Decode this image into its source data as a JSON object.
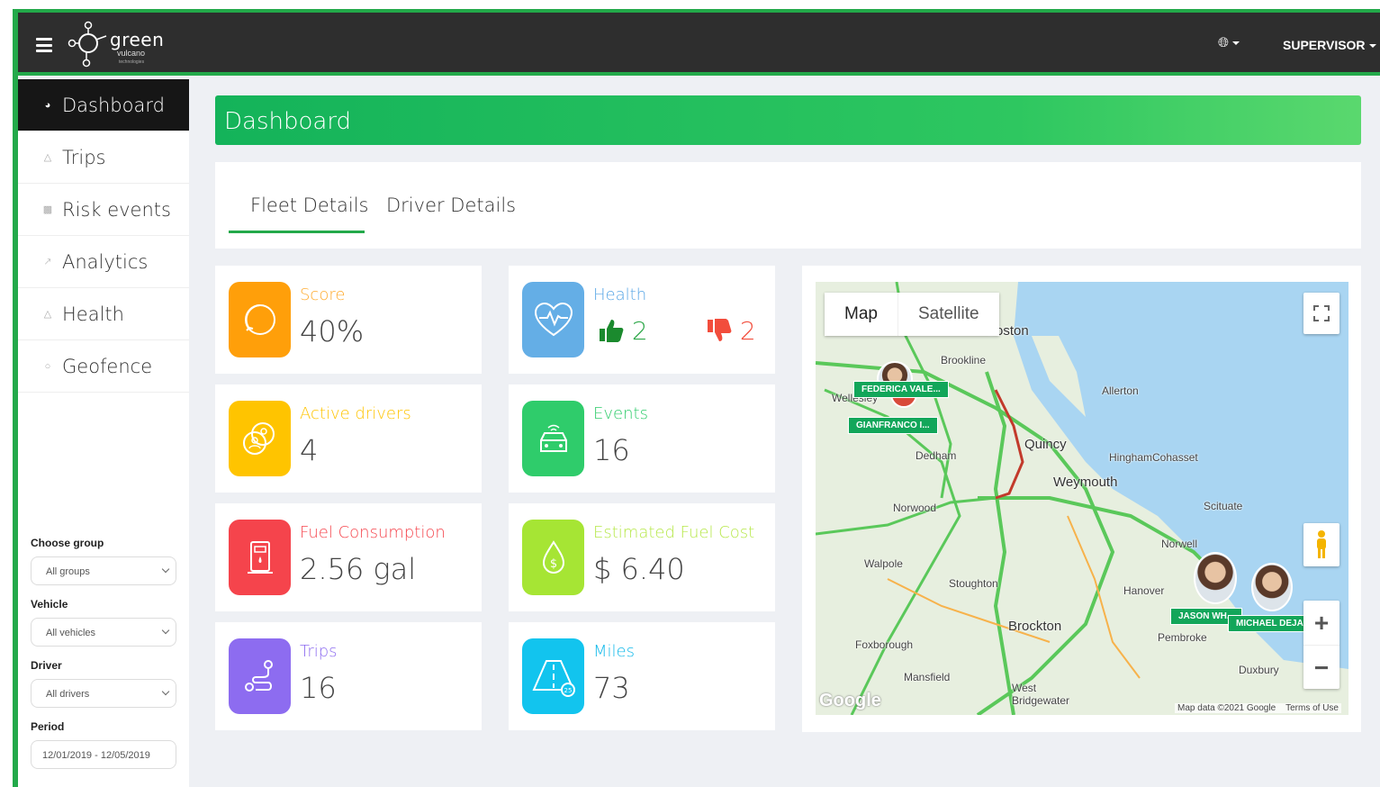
{
  "header": {
    "logo_text": "green",
    "logo_sub": "vulcano",
    "logo_sub2": "technologies",
    "language_icon": "globe-icon",
    "user_label": "SUPERVISOR"
  },
  "sidebar": {
    "items": [
      {
        "label": "Dashboard",
        "icon": "dashboard-icon",
        "active": true
      },
      {
        "label": "Trips",
        "icon": "road-icon"
      },
      {
        "label": "Risk events",
        "icon": "bar-chart-icon"
      },
      {
        "label": "Analytics",
        "icon": "line-chart-icon"
      },
      {
        "label": "Health",
        "icon": "bell-icon"
      },
      {
        "label": "Geofence",
        "icon": "circle-icon"
      }
    ],
    "filters": {
      "group_label": "Choose group",
      "group_value": "All groups",
      "vehicle_label": "Vehicle",
      "vehicle_value": "All vehicles",
      "driver_label": "Driver",
      "driver_value": "All drivers",
      "period_label": "Period",
      "period_value": "12/01/2019 - 12/05/2019"
    }
  },
  "page": {
    "title": "Dashboard",
    "tabs": [
      {
        "label": "Fleet Details",
        "active": true
      },
      {
        "label": "Driver Details"
      }
    ]
  },
  "cards": {
    "score": {
      "label": "Score",
      "value": "40%",
      "color": "#ff9f0a",
      "label_color": "#ffab2e"
    },
    "health": {
      "label": "Health",
      "up": "2",
      "down": "2",
      "color": "#64aee6",
      "label_color": "#5aa7e6"
    },
    "active_drivers": {
      "label": "Active drivers",
      "value": "4",
      "color": "#ffc400",
      "label_color": "#ffc400"
    },
    "events": {
      "label": "Events",
      "value": "16",
      "color": "#2fcc6b",
      "label_color": "#2fcc6b"
    },
    "fuel": {
      "label": "Fuel Consumption",
      "value": "2.56 gal",
      "color": "#f5444c",
      "label_color": "#f5444c"
    },
    "fuel_cost": {
      "label": "Estimated Fuel Cost",
      "value": "$ 6.40",
      "color": "#a6e534",
      "label_color": "#b7e84a"
    },
    "trips": {
      "label": "Trips",
      "value": "16",
      "color": "#8d6cf0",
      "label_color": "#8d6cf0"
    },
    "miles": {
      "label": "Miles",
      "value": "73",
      "color": "#12c4ee",
      "label_color": "#12b9ea"
    }
  },
  "map": {
    "type_map": "Map",
    "type_satellite": "Satellite",
    "places": [
      "Boston",
      "Brookline",
      "Allerton",
      "Quincy",
      "Dedham",
      "Hingham",
      "Cohasset",
      "Weymouth",
      "Norwood",
      "Scituate",
      "Norwell",
      "Walpole",
      "Stoughton",
      "Hanover",
      "Brockton",
      "Pembroke",
      "Foxborough",
      "Duxbury",
      "Mansfield",
      "West Bridgewater",
      "Wellesley"
    ],
    "drivers": [
      "FEDERICA VALE...",
      "GIANFRANCO I...",
      "JASON WH...",
      "MICHAEL DEJA..."
    ],
    "attribution": "Map data ©2021 Google",
    "terms": "Terms of Use",
    "google": "Google"
  }
}
